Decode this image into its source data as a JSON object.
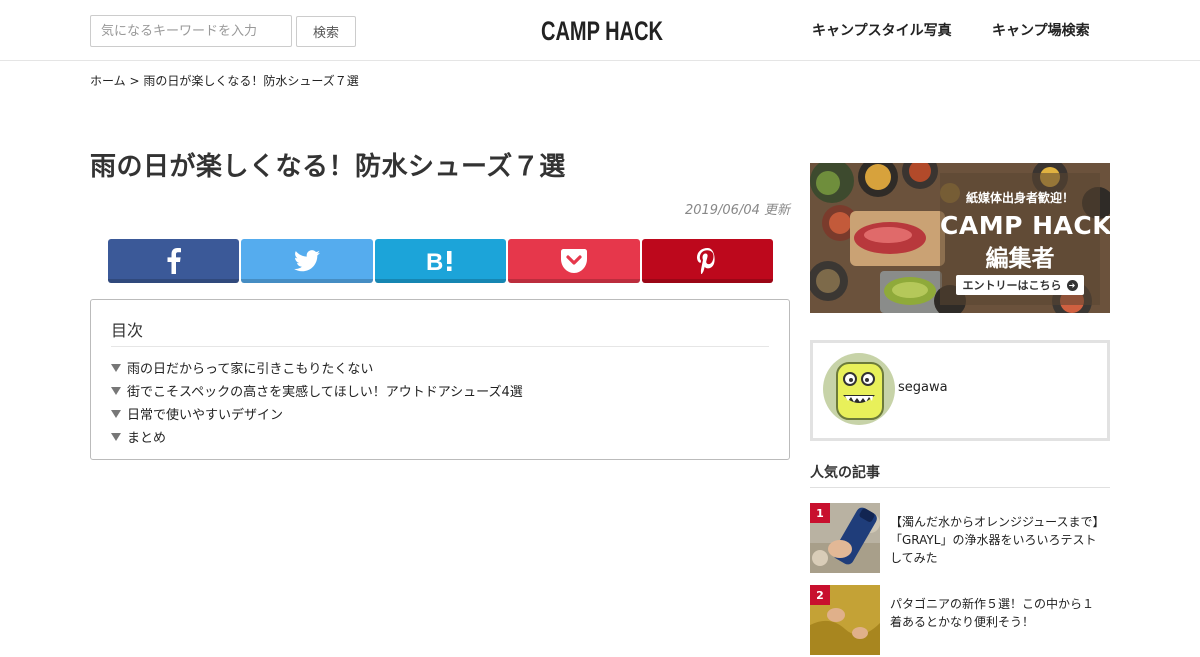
{
  "header": {
    "search_placeholder": "気になるキーワードを入力",
    "search_button": "検索",
    "logo_text": "CAMP HACK",
    "nav": [
      "キャンプスタイル写真",
      "キャンプ場検索"
    ]
  },
  "breadcrumb": {
    "home": "ホーム",
    "separator": ">",
    "current": "雨の日が楽しくなる！防水シューズ７選"
  },
  "article": {
    "title": "雨の日が楽しくなる！防水シューズ７選",
    "updated": "2019/06/04 更新"
  },
  "share": [
    {
      "name": "facebook",
      "icon": "facebook-icon",
      "color": "#3b5998"
    },
    {
      "name": "twitter",
      "icon": "twitter-bird-icon",
      "color": "#55acee"
    },
    {
      "name": "hatena",
      "icon": "hatena-bookmark-icon",
      "color": "#1ca4d9"
    },
    {
      "name": "pocket",
      "icon": "pocket-icon",
      "color": "#e6374b"
    },
    {
      "name": "pinterest",
      "icon": "pinterest-icon",
      "color": "#bd081c"
    }
  ],
  "toc": {
    "title": "目次",
    "items": [
      "雨の日だからって家に引きこもりたくない",
      "街でこそスペックの高さを実感してほしい！アウトドアシューズ4選",
      "日常で使いやすいデザイン",
      "まとめ"
    ]
  },
  "sidebar": {
    "banner": {
      "welcome": "紙媒体出身者歓迎！",
      "brand": "CAMP HACK",
      "role": "編集者",
      "cta": "エントリーはこちら"
    },
    "author": {
      "name": "segawa"
    },
    "popular_title": "人気の記事",
    "popular": [
      {
        "rank": "1",
        "title": "【濁んだ水からオレンジジュースまで】「GRAYL」の浄水器をいろいろテストしてみた"
      },
      {
        "rank": "2",
        "title": "パタゴニアの新作５選！この中から１着あるとかなり便利そう！"
      }
    ]
  },
  "colors": {
    "accent_red": "#c8102e",
    "facebook": "#3b5998",
    "twitter": "#55acee",
    "hatena": "#1ca4d9",
    "pocket": "#e6374b",
    "pinterest": "#bd081c"
  }
}
